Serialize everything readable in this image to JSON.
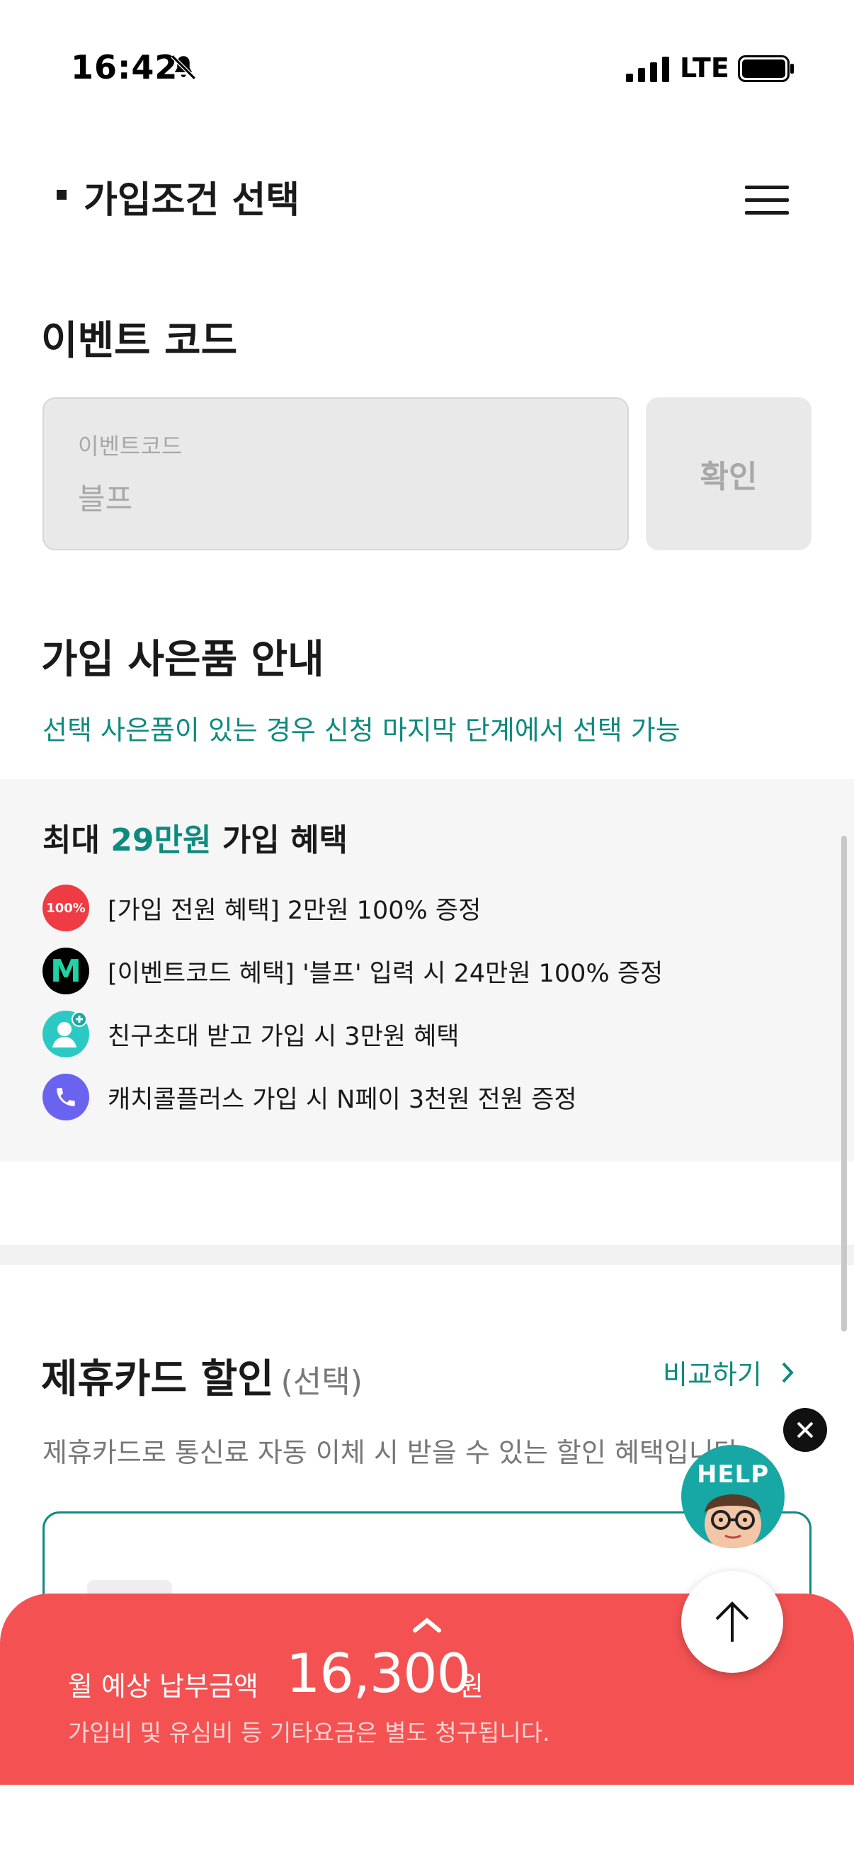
{
  "status_bar": {
    "time": "16:42",
    "network": "LTE"
  },
  "header": {
    "title": "가입조건 선택",
    "menu_icon": "hamburger-menu-icon"
  },
  "event_code": {
    "section_title": "이벤트 코드",
    "input_label": "이벤트코드",
    "input_value": "블프",
    "confirm_label": "확인"
  },
  "gift": {
    "section_title": "가입 사은품 안내",
    "subtitle": "선택 사은품이 있는 경우 신청 마지막 단계에서 선택 가능",
    "heading_prefix": "최대 ",
    "heading_amount": "29만원",
    "heading_suffix": " 가입 혜택",
    "items": [
      {
        "icon": "100-percent-badge-icon",
        "icon_text": "100%",
        "text": "[가입 전원 혜택] 2만원 100% 증정"
      },
      {
        "icon": "m-logo-icon",
        "icon_text": "M",
        "text": "[이벤트코드 혜택] '블프' 입력 시 24만원 100% 증정"
      },
      {
        "icon": "friend-invite-icon",
        "text": "친구초대 받고 가입 시 3만원 혜택"
      },
      {
        "icon": "phone-icon",
        "text": "캐치콜플러스 가입 시 N페이 3천원 전원 증정"
      }
    ]
  },
  "card_discount": {
    "title": "제휴카드 할인",
    "title_optional": "(선택)",
    "compare_label": "비교하기",
    "subtitle": "제휴카드로 통신료 자동 이체 시 받을 수 있는 할인 혜택입니다."
  },
  "help": {
    "label": "HELP"
  },
  "bottom_bar": {
    "monthly_label": "월 예상 납부금액",
    "amount": "16,300",
    "unit": "원",
    "note": "가입비 및 유심비 등 기타요금은 별도 청구됩니다."
  },
  "colors": {
    "accent": "#0f8a7e",
    "bottom_bar": "#f45252",
    "benefit_box": "#f6f6f6"
  }
}
